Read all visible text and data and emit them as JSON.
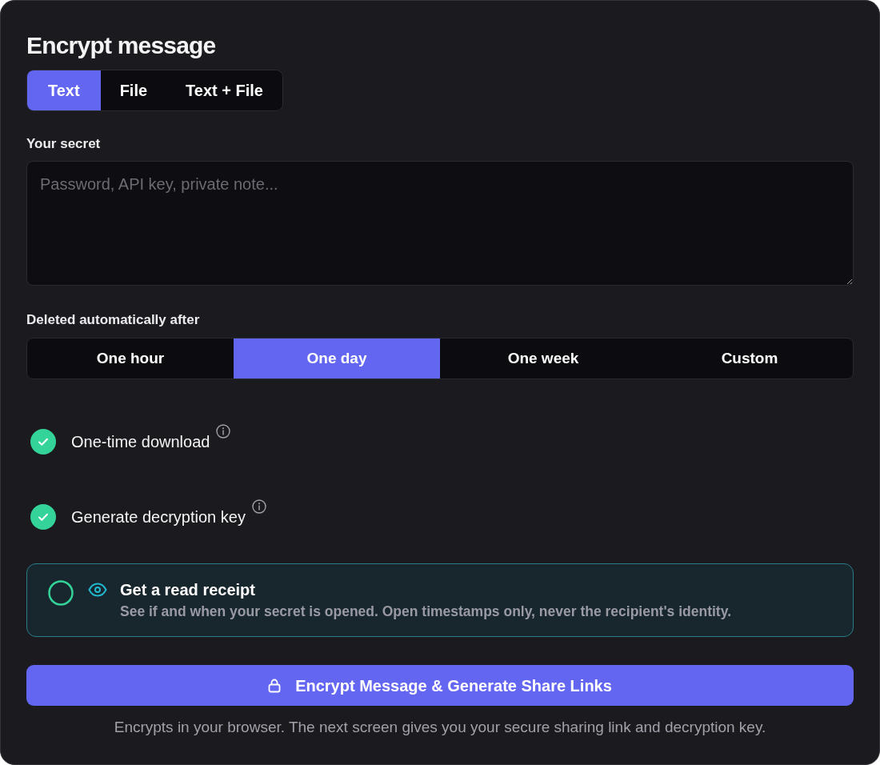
{
  "title": "Encrypt message",
  "mode_tabs": [
    {
      "label": "Text",
      "selected": true
    },
    {
      "label": "File",
      "selected": false
    },
    {
      "label": "Text + File",
      "selected": false
    }
  ],
  "secret": {
    "label": "Your secret",
    "placeholder": "Password, API key, private note..."
  },
  "expiry": {
    "label": "Deleted automatically after",
    "options": [
      {
        "label": "One hour",
        "selected": false
      },
      {
        "label": "One day",
        "selected": true
      },
      {
        "label": "One week",
        "selected": false
      },
      {
        "label": "Custom",
        "selected": false
      }
    ]
  },
  "options": [
    {
      "label": "One-time download",
      "checked": true
    },
    {
      "label": "Generate decryption key",
      "checked": true
    }
  ],
  "read_receipt": {
    "title": "Get a read receipt",
    "description": "See if and when your secret is opened. Open timestamps only, never the recipient's identity.",
    "checked": false
  },
  "submit_button": {
    "label": "Encrypt Message & Generate Share Links"
  },
  "footnote": "Encrypts in your browser. The next screen gives you your secure sharing link and decryption key."
}
